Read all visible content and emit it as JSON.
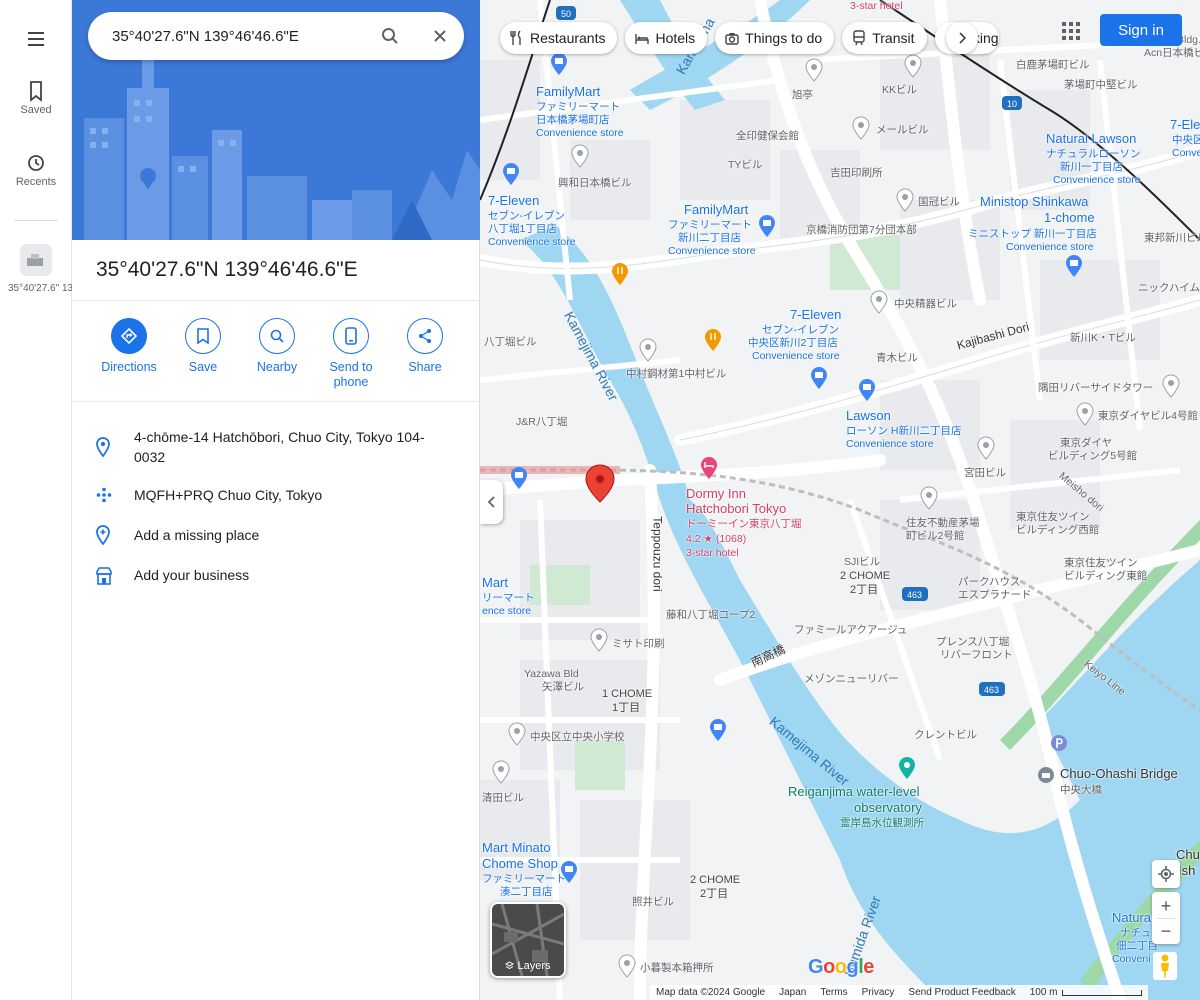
{
  "rail": {
    "menu_icon": "menu-icon",
    "saved_label": "Saved",
    "recents_label": "Recents",
    "recent_item_text": "35°40'27.6\" 139°46'46.6"
  },
  "search": {
    "value": "35°40'27.6\"N 139°46'46.6\"E",
    "search_icon": "search-icon",
    "close_icon": "close-icon"
  },
  "place": {
    "title": "35°40'27.6\"N 139°46'46.6\"E"
  },
  "actions": [
    {
      "label": "Directions",
      "icon": "directions-icon"
    },
    {
      "label": "Save",
      "icon": "bookmark-icon"
    },
    {
      "label": "Nearby",
      "icon": "nearby-icon"
    },
    {
      "label": "Send to phone",
      "icon": "phone-icon"
    },
    {
      "label": "Share",
      "icon": "share-icon"
    }
  ],
  "info": {
    "address": "4-chōme-14 Hatchōbori, Chuo City, Tokyo 104-0032",
    "plus_code": "MQFH+PRQ Chuo City, Tokyo",
    "add_missing_place": "Add a missing place",
    "add_business": "Add your business"
  },
  "chips": [
    {
      "label": "Restaurants",
      "icon": "restaurant-icon"
    },
    {
      "label": "Hotels",
      "icon": "hotel-icon"
    },
    {
      "label": "Things to do",
      "icon": "camera-icon"
    },
    {
      "label": "Transit",
      "icon": "train-icon"
    },
    {
      "label": "Parking",
      "icon": "parking-icon"
    }
  ],
  "topbar": {
    "sign_in": "Sign in"
  },
  "map_labels": {
    "family_mart_1": "FamilyMart",
    "family_mart_1_jp": "ファミリーマート",
    "family_mart_1_jp2": "日本橋茅場町店",
    "convenience_store": "Convenience store",
    "family_mart_2": "FamilyMart",
    "family_mart_2_jp": "ファミリーマート",
    "family_mart_2_jp2": "新川二丁目店",
    "seven_eleven_1": "7-Eleven",
    "seven_eleven_1_jp": "セブン-イレブン",
    "seven_eleven_1_jp2": "八丁堀1丁目店",
    "seven_eleven_2": "7-Eleven",
    "seven_eleven_2_jp": "セブン-イレブン",
    "seven_eleven_2_jp2": "中央区新川2丁目店",
    "seven_eleven_3": "7-Eleven",
    "seven_eleven_3_jp": "セブン-イレブン",
    "seven_eleven_3_jp2": "中央区湊1丁目店",
    "lawson": "Lawson",
    "lawson_jp": "ローソン H新川二丁目店",
    "natural_lawson": "Natural Lawson",
    "natural_lawson_jp": "ナチュラルローソン",
    "natural_lawson_jp2": "新川一丁目店",
    "ministop": "Ministop Shinkawa",
    "ministop_2": "1-chome",
    "ministop_jp": "ミニストップ 新川一丁目店",
    "dormy_inn": "Dormy Inn",
    "dormy_inn_2": "Hatchobori Tokyo",
    "dormy_inn_jp": "ドーミーイン東京八丁堀",
    "dormy_inn_rating": "4.2 ★ (1068)",
    "dormy_inn_type": "3-star hotel",
    "hotel_top": "3-star hotel",
    "kamejima_river_1": "Kamejima River",
    "kamejima_river_2": "Kamejima River",
    "kamejima_river_3": "Kamejima River",
    "kamejima_top": "Kamejima",
    "sumida_river": "Sumida River",
    "kajibashi_dori": "Kajibashi Dori",
    "teppouzu_dori": "Teppouzu dori",
    "meisho_dori": "Meisho dori",
    "keiyo_line": "Keiyo Line",
    "nanko_bashi": "南高橋",
    "reiganjima": "Reiganjima water-level",
    "reiganjima_2": "observatory",
    "reiganjima_jp": "霊岸島水位観測所",
    "chuo_ohashi": "Chuo-Ohashi Bridge",
    "chuo_ohashi_jp": "中央大橋",
    "two_chome_1": "2 CHOME",
    "two_chome_1_jp": "2丁目",
    "one_chome": "1 CHOME",
    "one_chome_jp": "1丁目",
    "two_chome_2": "2 CHOME",
    "two_chome_2_jp": "2丁目",
    "bldg_kk": "KKビル",
    "bldg_meru": "メールビル",
    "bldg_zenin": "全印健保会館",
    "bldg_ty": "TYビル",
    "bldg_yoshida": "吉田印刷所",
    "bldg_kokuka": "国冠ビル",
    "bldg_keikyo": "京橋消防団第7分団本部",
    "bldg_chuoseiki": "中央精器ビル",
    "bldg_aoki": "青木ビル",
    "bldg_nakamura": "中村鋼材第1中村ビル",
    "bldg_sumida_river_tower": "隅田リバーサイドタワー",
    "bldg_tokyo_daiya4": "東京ダイヤビル4号館",
    "bldg_tokyo_daiya5a": "東京ダイヤ",
    "bldg_tokyo_daiya5b": "ビルディング5号館",
    "bldg_miyata": "宮田ビル",
    "bldg_sumitomo_a": "住友不動産茅場",
    "bldg_sumitomo_b": "町ビル2号館",
    "bldg_sj": "SJIビル",
    "bldg_park_a": "パークハウス",
    "bldg_park_b": "エスプラナード",
    "bldg_tokyo_sumitomo_w_a": "東京住友ツイン",
    "bldg_tokyo_sumitomo_w_b": "ビルディング西館",
    "bldg_tokyo_sumitomo_e_a": "東京住友ツイン",
    "bldg_tokyo_sumitomo_e_b": "ビルディング東館",
    "bldg_fujikazu": "藤和八丁堀コープ2",
    "bldg_misato": "ミサト印刷",
    "bldg_family_aqua": "ファミールアクアージュ",
    "bldg_presence_a": "プレンス八丁堀",
    "bldg_presence_b": "リバーフロント",
    "bldg_maison": "メゾンニューリバー",
    "bldg_crane": "クレントビル",
    "bldg_yazawa_a": "Yazawa Bld",
    "bldg_yazawa_b": "矢澤ビル",
    "bldg_school": "中央区立中央小学校",
    "bldg_kiyota": "清田ビル",
    "bldg_shorin": "照井ビル",
    "bldg_kogure": "小暮製本箱押所",
    "bldg_jr": "J&R八丁堀",
    "bldg_hatchobori_biru": "八丁堀ビル",
    "bldg_kokonoe": "興和日本橋ビル",
    "bldg_asahi": "旭亭",
    "bldg_shirohiko": "白鹿茅場町ビル",
    "bldg_kayaba_chusei": "茅場町中堅ビル",
    "bldg_acn": "Acn日本橋ビル",
    "bldg_acn_top": "Acn Bldg.",
    "bldg_shinkawa_kt": "新川K・Tビル",
    "bldg_tosei_shinkawa": "東邦新川ビル",
    "bldg_nikkin": "ニックハイム",
    "mart_minato_a": "Mart Minato",
    "mart_minato_b": "Chome Shop",
    "mart_minato_c": "ファミリーマート",
    "mart_minato_d": "湊二丁目店",
    "mart_left_a": "Mart",
    "mart_left_b": "リーマート",
    "mart_left_c": "ence store",
    "natural_lawson_2": "Natura",
    "natural_lawson_2_jp": "ナチュ",
    "natural_lawson_2_jp2": "佃二丁目",
    "natural_lawson_2_c": "Conveni",
    "seven_right_a": "7-Ele",
    "seven_right_b": "中央区",
    "seven_right_c": "Conve",
    "chuo_right_a": "Chu",
    "chuo_right_b": "Ish",
    "road_463_1": "463",
    "road_463_2": "463",
    "road_10": "10",
    "road_50": "50"
  },
  "map_controls": {
    "layers_label": "Layers",
    "zoom_in": "+",
    "zoom_out": "−",
    "google_logo": "Google"
  },
  "attribution": {
    "map_data": "Map data ©2024 Google",
    "japan": "Japan",
    "terms": "Terms",
    "privacy": "Privacy",
    "feedback": "Send Product Feedback",
    "scale": "100 m"
  }
}
